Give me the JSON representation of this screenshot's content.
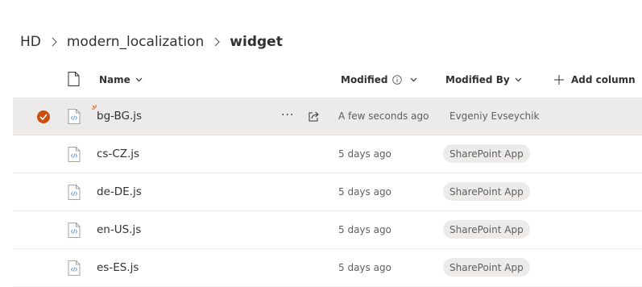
{
  "breadcrumb": {
    "items": [
      "HD",
      "modern_localization",
      "widget"
    ]
  },
  "columns": {
    "name": "Name",
    "modified": "Modified",
    "modified_by": "Modified By",
    "add_column": "Add column"
  },
  "files": [
    {
      "name": "bg-BG.js",
      "modified": "A few seconds ago",
      "modified_by": "Evgeniy Evseychik",
      "selected": true,
      "new": true
    },
    {
      "name": "cs-CZ.js",
      "modified": "5 days ago",
      "modified_by": "SharePoint App"
    },
    {
      "name": "de-DE.js",
      "modified": "5 days ago",
      "modified_by": "SharePoint App"
    },
    {
      "name": "en-US.js",
      "modified": "5 days ago",
      "modified_by": "SharePoint App"
    },
    {
      "name": "es-ES.js",
      "modified": "5 days ago",
      "modified_by": "SharePoint App"
    }
  ],
  "row_actions": {
    "more": "···"
  },
  "colors": {
    "accent": "#ca5010",
    "selected_row": "#edebe9",
    "badge_bg": "#edebe9",
    "file_icon": "#4f8fcf"
  }
}
